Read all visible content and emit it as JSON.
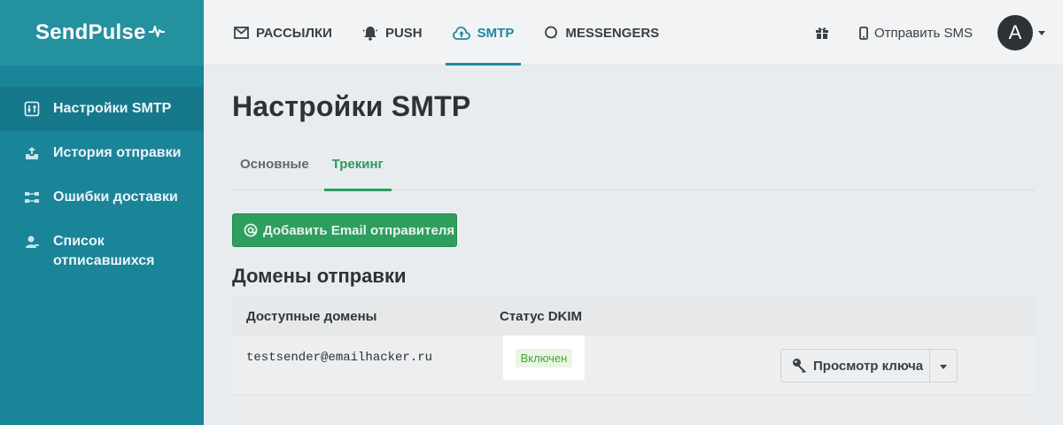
{
  "brand": {
    "name": "SendPulse"
  },
  "colors": {
    "sidebar": "#1a8498",
    "accent": "#1c8aa0",
    "green": "#2e9e5e",
    "badge_text": "#4aa33d"
  },
  "topnav": {
    "items": [
      {
        "label": "РАССЫЛКИ",
        "icon": "envelope-icon"
      },
      {
        "label": "PUSH",
        "icon": "bell-icon"
      },
      {
        "label": "SMTP",
        "icon": "cloud-upload-icon",
        "active": true
      },
      {
        "label": "MESSENGERS",
        "icon": "chat-bubble-icon"
      }
    ],
    "sms_label": "Отправить SMS",
    "avatar_letter": "A"
  },
  "sidebar": {
    "items": [
      {
        "label": "Настройки SMTP",
        "icon": "settings-sliders-icon",
        "active": true
      },
      {
        "label": "История отправки",
        "icon": "upload-tray-icon"
      },
      {
        "label": "Ошибки доставки",
        "icon": "error-flow-icon"
      },
      {
        "label": "Список отписавшихся",
        "icon": "user-minus-icon"
      }
    ]
  },
  "main": {
    "title": "Настройки SMTP",
    "tabs": [
      {
        "label": "Основные"
      },
      {
        "label": "Трекинг",
        "active": true
      }
    ],
    "add_sender_label": "Добавить Email отправителя",
    "domains_title": "Домены отправки",
    "table": {
      "headers": [
        "Доступные домены",
        "Статус DKIM"
      ],
      "rows": [
        {
          "domain": "testsender@emailhacker.ru",
          "status": "Включен",
          "action": "Просмотр ключа"
        }
      ]
    }
  }
}
